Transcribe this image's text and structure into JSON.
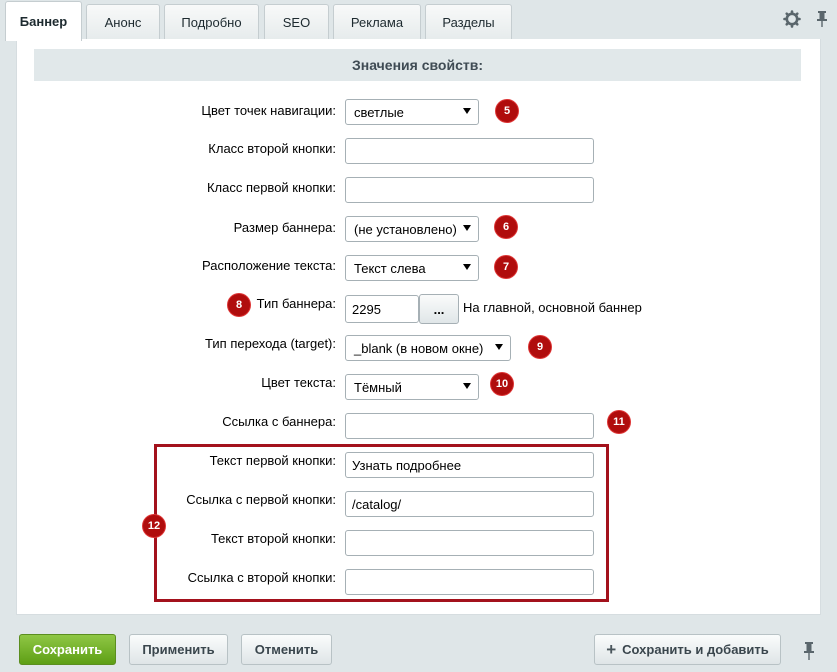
{
  "tabs": [
    "Баннер",
    "Анонс",
    "Подробно",
    "SEO",
    "Реклама",
    "Разделы"
  ],
  "section_title": "Значения свойств:",
  "fields": {
    "nav_dots": {
      "label": "Цвет точек навигации:",
      "value": "светлые",
      "badge": "5"
    },
    "second_btn_class": {
      "label": "Класс второй кнопки:",
      "value": ""
    },
    "first_btn_class": {
      "label": "Класс первой кнопки:",
      "value": ""
    },
    "banner_size": {
      "label": "Размер баннера:",
      "value": "(не установлено)",
      "badge": "6"
    },
    "text_position": {
      "label": "Расположение текста:",
      "value": "Текст слева",
      "badge": "7"
    },
    "banner_type": {
      "label": "Тип баннера:",
      "value": "2295",
      "button": "...",
      "note": "На главной, основной баннер",
      "badge": "8"
    },
    "target": {
      "label": "Тип перехода (target):",
      "value": "_blank (в новом окне)",
      "badge": "9"
    },
    "text_color": {
      "label": "Цвет текста:",
      "value": "Тёмный",
      "badge": "10"
    },
    "banner_link": {
      "label": "Ссылка с баннера:",
      "value": "",
      "badge": "11"
    },
    "first_btn_text": {
      "label": "Текст первой кнопки:",
      "value": "Узнать подробнее"
    },
    "first_btn_link": {
      "label": "Ссылка с первой кнопки:",
      "value": "/catalog/"
    },
    "second_btn_text": {
      "label": "Текст второй кнопки:",
      "value": ""
    },
    "second_btn_link": {
      "label": "Ссылка с второй кнопки:",
      "value": ""
    }
  },
  "group_badge": "12",
  "footer": {
    "save": "Сохранить",
    "apply": "Применить",
    "cancel": "Отменить",
    "save_add": "Сохранить и добавить",
    "save_add_icon": "+"
  },
  "colors": {
    "accent_red": "#b00d0d",
    "save_green": "#6aab1e",
    "highlight_border": "#a3111c"
  }
}
